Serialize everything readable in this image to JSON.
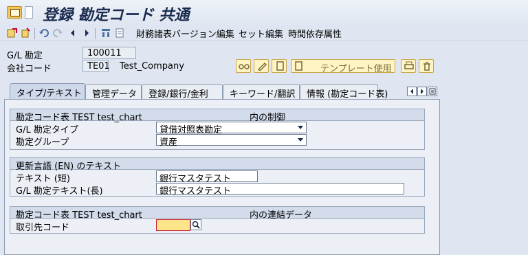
{
  "title": "登録 勘定コード 共通",
  "toolbar": {
    "menu1": "財務諸表バージョン編集",
    "menu2": "セット編集",
    "menu3": "時間依存属性"
  },
  "header": {
    "gl_label": "G/L 勘定",
    "gl_value": "100011",
    "company_label": "会社コード",
    "company_value": "TE01",
    "company_name": "Test_Company",
    "template_button": "テンプレート使用"
  },
  "tabs": [
    {
      "label": "タイプ/テキスト",
      "active": true
    },
    {
      "label": "管理データ"
    },
    {
      "label": "登録/銀行/金利"
    },
    {
      "label": "キーワード/翻訳"
    },
    {
      "label": "情報 (勘定コード表)"
    }
  ],
  "group1": {
    "title_left": "勘定コード表 TEST test_chart",
    "title_right": "内の制御",
    "type_label": "G/L 勘定タイプ",
    "type_value": "貸借対照表勘定",
    "group_label": "勘定グループ",
    "group_value": "資産"
  },
  "group2": {
    "title": "更新言語 (EN) のテキスト",
    "short_label": "テキスト (短)",
    "short_value": "銀行マスタテスト",
    "long_label": "G/L 勘定テキスト(長)",
    "long_value": "銀行マスタテスト"
  },
  "group3": {
    "title_left": "勘定コード表 TEST test_chart",
    "title_right": "内の連結データ",
    "partner_label": "取引先コード",
    "partner_value": ""
  }
}
